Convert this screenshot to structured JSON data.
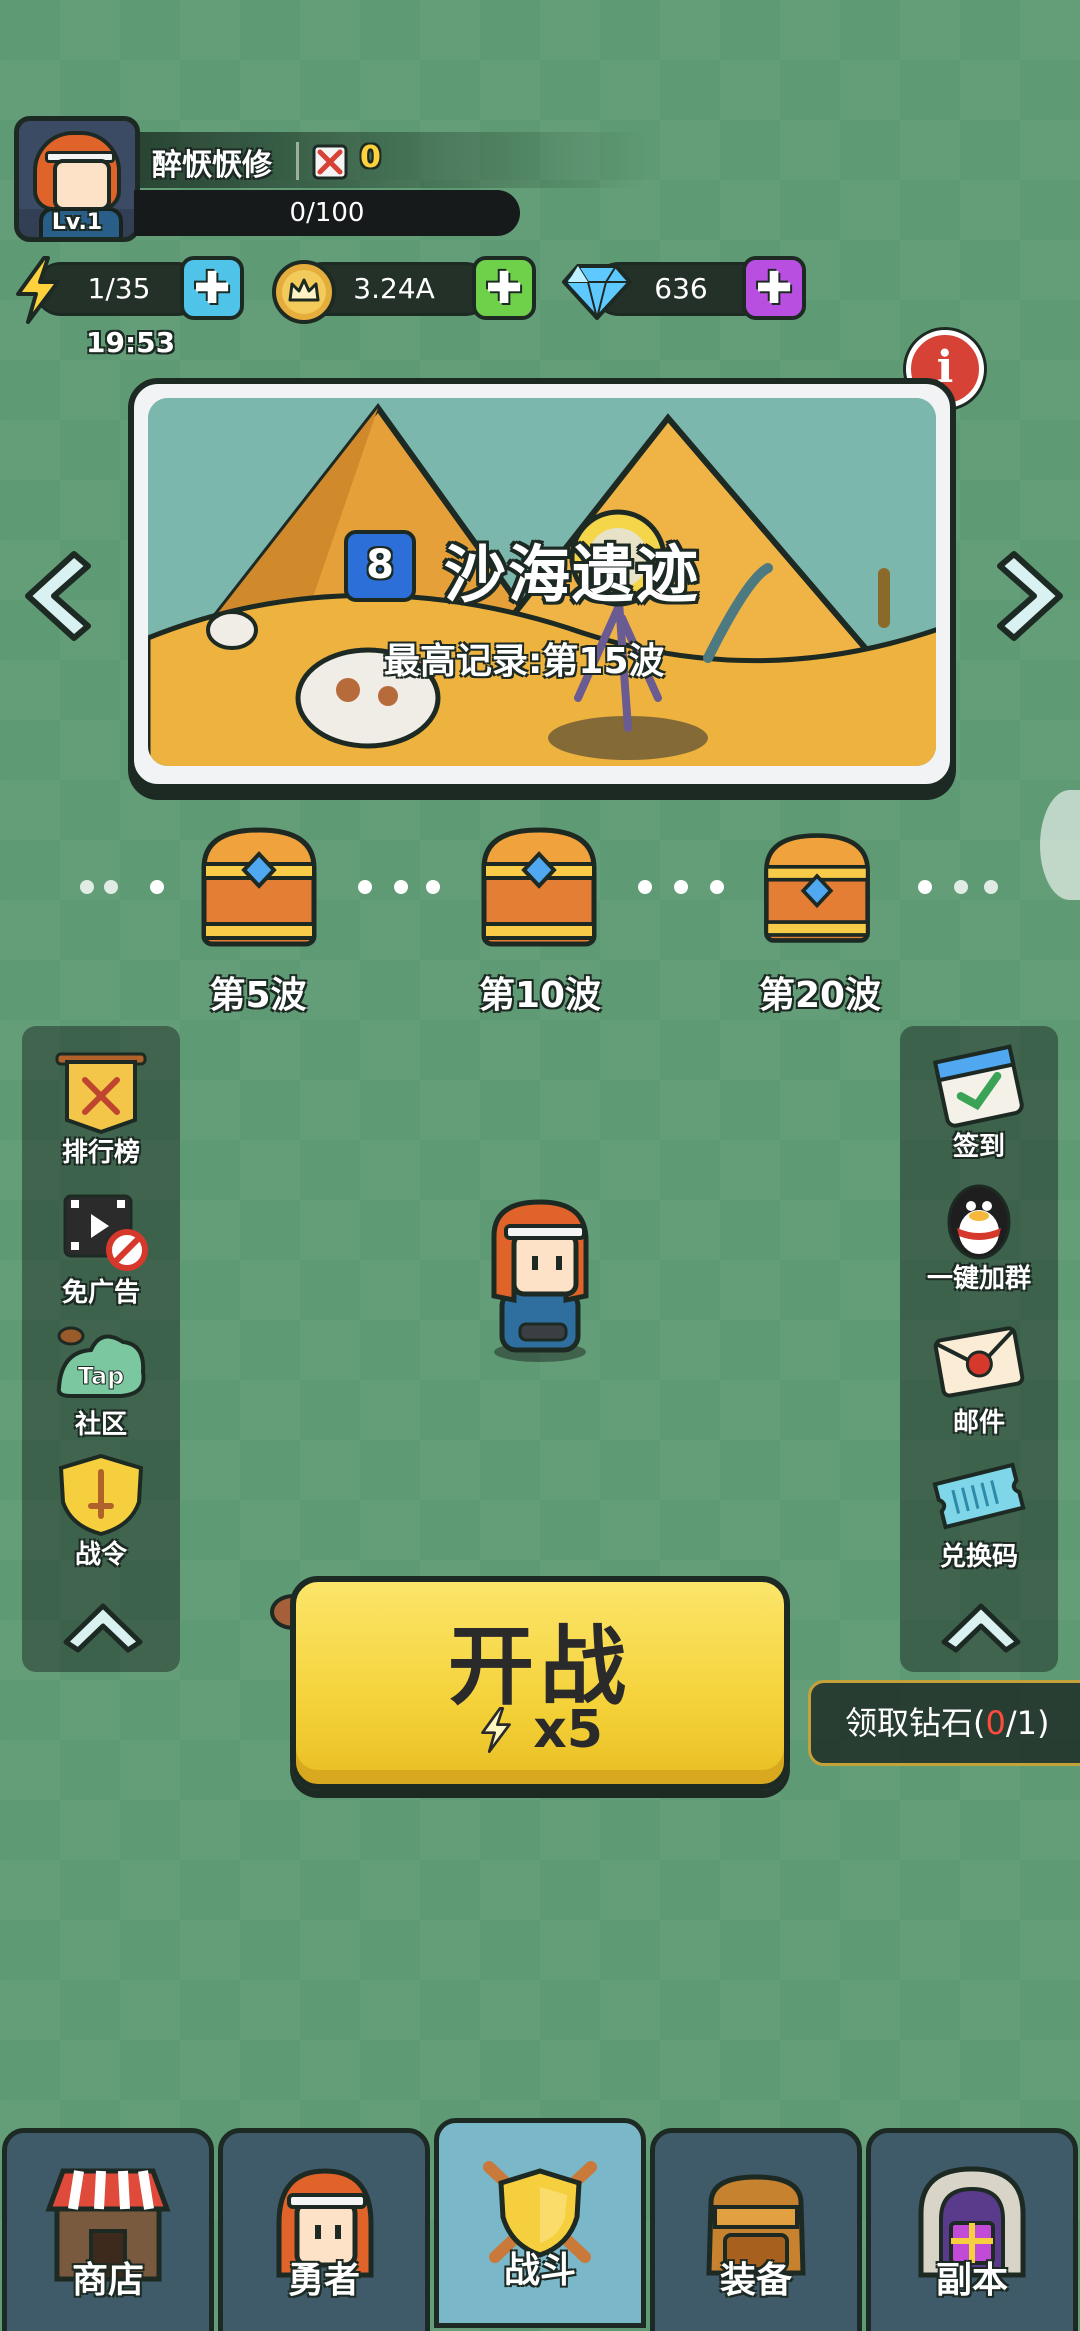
{
  "player": {
    "name": "醉恹恹修",
    "level": "Lv.1",
    "power": "0",
    "exp": "0/100"
  },
  "resources": {
    "energy": "1/35",
    "energy_timer": "19:53",
    "gold": "3.24A",
    "diamonds": "636"
  },
  "stage": {
    "number": "8",
    "name": "沙海遗迹",
    "record": "最高记录:第15波"
  },
  "chests": [
    {
      "label": "第5波"
    },
    {
      "label": "第10波"
    },
    {
      "label": "第20波"
    }
  ],
  "left_menu": [
    {
      "label": "排行榜",
      "icon": "leaderboard-banner-icon"
    },
    {
      "label": "免广告",
      "icon": "no-ads-icon"
    },
    {
      "label": "社区",
      "icon": "tap-community-icon",
      "badge": "Tap"
    },
    {
      "label": "战令",
      "icon": "battle-pass-shield-icon"
    }
  ],
  "right_menu": [
    {
      "label": "签到",
      "icon": "calendar-checkin-icon"
    },
    {
      "label": "一键加群",
      "icon": "penguin-group-icon"
    },
    {
      "label": "邮件",
      "icon": "mail-envelope-icon"
    },
    {
      "label": "兑换码",
      "icon": "redeem-ticket-icon"
    }
  ],
  "battle": {
    "label": "开战",
    "cost": "x5"
  },
  "diamond_claim": {
    "prefix": "领取钻石(",
    "current": "0",
    "suffix": "/1)"
  },
  "nav": [
    {
      "label": "商店",
      "icon": "shop-icon"
    },
    {
      "label": "勇者",
      "icon": "hero-icon"
    },
    {
      "label": "战斗",
      "icon": "battle-icon",
      "active": true
    },
    {
      "label": "装备",
      "icon": "backpack-icon"
    },
    {
      "label": "副本",
      "icon": "dungeon-gate-icon"
    }
  ],
  "colors": {
    "background": "#5e9a73",
    "battle_button": "#f5d23a",
    "energy_plus": "#4fc3e8",
    "gold_plus": "#6fd14a",
    "diamond_plus": "#b84fe0",
    "info_button": "#d74236",
    "stage_badge": "#2d6fd8",
    "active_tab": "#7ab7c8"
  }
}
